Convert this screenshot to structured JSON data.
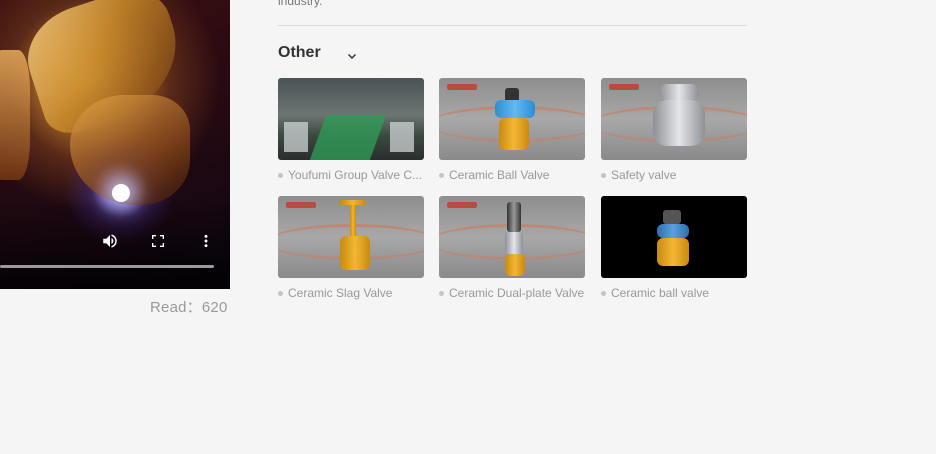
{
  "video": {
    "read_label": "Read：620"
  },
  "intro_text": "industry.",
  "section": {
    "title": "Other"
  },
  "products": [
    {
      "caption": "Youfumi Group Valve C..."
    },
    {
      "caption": "Ceramic Ball Valve"
    },
    {
      "caption": "Safety valve"
    },
    {
      "caption": "Ceramic Slag Valve"
    },
    {
      "caption": "Ceramic Dual-plate Valve"
    },
    {
      "caption": "Ceramic ball valve"
    }
  ]
}
